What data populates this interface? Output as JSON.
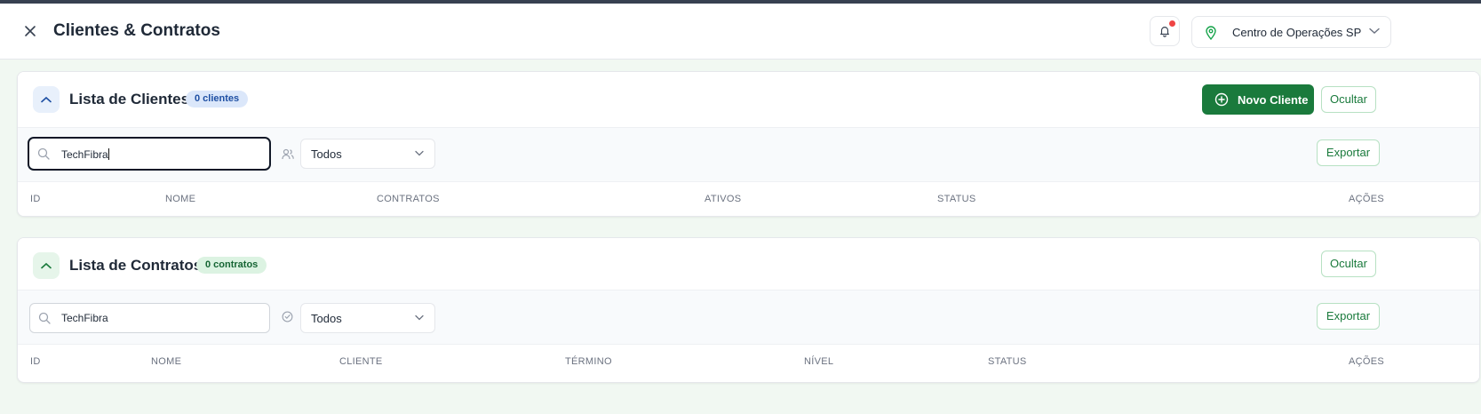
{
  "header": {
    "title": "Clientes & Contratos",
    "location": "Centro de Operações SP"
  },
  "clients": {
    "title": "Lista de Clientes",
    "badge": "0 clientes",
    "new_button": "Novo Cliente",
    "hide_button": "Ocultar",
    "search_value": "TechFibra",
    "filter_value": "Todos",
    "export_button": "Exportar",
    "columns": [
      "ID",
      "NOME",
      "CONTRATOS",
      "ATIVOS",
      "STATUS",
      "AÇÕES"
    ]
  },
  "contracts": {
    "title": "Lista de Contratos",
    "badge": "0 contratos",
    "hide_button": "Ocultar",
    "search_value": "TechFibra",
    "filter_value": "Todos",
    "export_button": "Exportar",
    "columns": [
      "ID",
      "NOME",
      "CLIENTE",
      "TÉRMINO",
      "NÍVEL",
      "STATUS",
      "AÇÕES"
    ]
  },
  "colors": {
    "primary_green": "#1a7a3c",
    "accent_blue": "#1e4fa3",
    "notification_red": "#ef4444"
  },
  "icons": [
    "close-icon",
    "bell-icon",
    "map-pin-icon",
    "chevron-down-icon",
    "chevron-up-icon",
    "plus-circle-icon",
    "search-icon",
    "users-icon",
    "check-circle-icon"
  ]
}
